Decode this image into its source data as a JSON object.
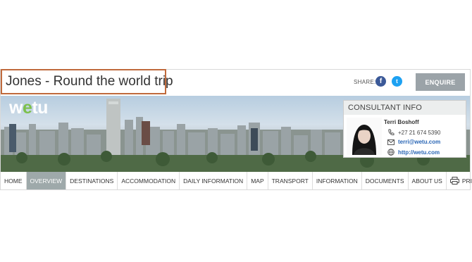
{
  "header": {
    "trip_title": "Jones - Round the world trip",
    "share_label": "SHARE:",
    "enquire_label": "ENQUIRE"
  },
  "social": [
    {
      "name": "facebook",
      "glyph": "f",
      "color": "#3b5998"
    },
    {
      "name": "twitter",
      "glyph": "t",
      "color": "#1da1f2"
    }
  ],
  "brand": {
    "logo_text_w": "w",
    "logo_text_e": "e",
    "logo_text_rest": "tu"
  },
  "consultant": {
    "heading": "CONSULTANT INFO",
    "name": "Terri Boshoff",
    "phone": "+27 21 674 5390",
    "email": "terri@wetu.com",
    "website": "http://wetu.com"
  },
  "nav": {
    "items": [
      "HOME",
      "OVERVIEW",
      "DESTINATIONS",
      "ACCOMMODATION",
      "DAILY INFORMATION",
      "MAP",
      "TRANSPORT",
      "INFORMATION",
      "DOCUMENTS",
      "ABOUT US"
    ],
    "active": "OVERVIEW",
    "print_label": "PRINT"
  },
  "icons": [
    "phone-icon",
    "mail-icon",
    "globe-icon",
    "printer-icon",
    "facebook-icon",
    "twitter-icon"
  ],
  "colors": {
    "title_border": "#c06a3c",
    "enquire_bg": "#9ba3a8",
    "link": "#2a66b5",
    "active_nav": "#9ea9aa",
    "logo_accent": "#7cc04b"
  }
}
